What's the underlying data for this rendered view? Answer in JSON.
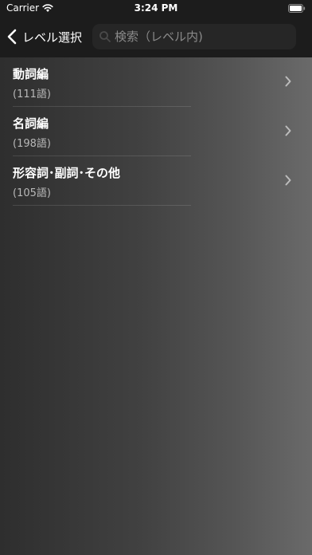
{
  "status_bar": {
    "carrier": "Carrier",
    "time": "3:24 PM"
  },
  "nav": {
    "back_label": "レベル選択",
    "search_placeholder": "検索（レベル内)"
  },
  "list": {
    "items": [
      {
        "title": "動詞編",
        "count": "(111語)"
      },
      {
        "title": "名詞編",
        "count": "(198語)"
      },
      {
        "title": "形容詞･副詞･その他",
        "count": "(105語)"
      }
    ]
  },
  "colors": {
    "bar_background": "#1c1c1c",
    "search_background": "#262626",
    "text_primary": "#ffffff",
    "text_secondary": "#b8b8b8",
    "placeholder": "#8a8a8a"
  }
}
